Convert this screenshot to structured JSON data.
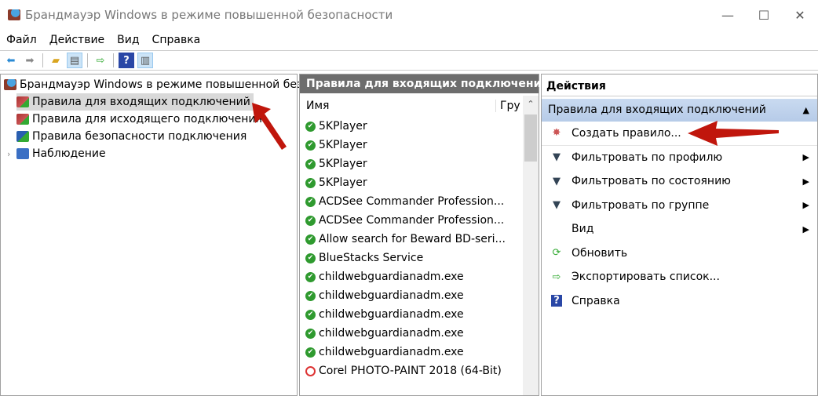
{
  "window": {
    "title": "Брандмауэр Windows в режиме повышенной безопасности"
  },
  "menu": [
    "Файл",
    "Действие",
    "Вид",
    "Справка"
  ],
  "tree": {
    "root": "Брандмауэр Windows в режиме повышенной безопасности",
    "items": [
      "Правила для входящих подключений",
      "Правила для исходящего подключения",
      "Правила безопасности подключения",
      "Наблюдение"
    ]
  },
  "middle": {
    "header": "Правила для входящих подключений",
    "columns": [
      "Имя",
      "Гру"
    ],
    "rows": [
      {
        "name": "5KPlayer",
        "status": "enabled"
      },
      {
        "name": "5KPlayer",
        "status": "enabled"
      },
      {
        "name": "5KPlayer",
        "status": "enabled"
      },
      {
        "name": "5KPlayer",
        "status": "enabled"
      },
      {
        "name": "ACDSee Commander Profession...",
        "status": "enabled"
      },
      {
        "name": "ACDSee Commander Profession...",
        "status": "enabled"
      },
      {
        "name": "Allow search for Beward BD-seri...",
        "status": "enabled"
      },
      {
        "name": "BlueStacks Service",
        "status": "enabled"
      },
      {
        "name": "childwebguardianadm.exe",
        "status": "enabled"
      },
      {
        "name": "childwebguardianadm.exe",
        "status": "enabled"
      },
      {
        "name": "childwebguardianadm.exe",
        "status": "enabled"
      },
      {
        "name": "childwebguardianadm.exe",
        "status": "enabled"
      },
      {
        "name": "childwebguardianadm.exe",
        "status": "enabled"
      },
      {
        "name": "Corel PHOTO-PAINT 2018 (64-Bit)",
        "status": "blocked"
      }
    ]
  },
  "actions": {
    "header": "Действия",
    "section": "Правила для входящих подключений",
    "items": [
      {
        "label": "Создать правило...",
        "icon": "new-rule-icon",
        "submenu": false
      },
      {
        "label": "Фильтровать по профилю",
        "icon": "filter-icon",
        "submenu": true
      },
      {
        "label": "Фильтровать по состоянию",
        "icon": "filter-icon",
        "submenu": true
      },
      {
        "label": "Фильтровать по группе",
        "icon": "filter-icon",
        "submenu": true
      },
      {
        "label": "Вид",
        "icon": "",
        "submenu": true
      },
      {
        "label": "Обновить",
        "icon": "refresh-icon",
        "submenu": false
      },
      {
        "label": "Экспортировать список...",
        "icon": "export-icon",
        "submenu": false
      },
      {
        "label": "Справка",
        "icon": "help-icon",
        "submenu": false
      }
    ]
  },
  "colors": {
    "accent_arrow": "#c0160c",
    "section_bg": "#c2d5ee",
    "mid_header_bg": "#6d6d6d"
  }
}
